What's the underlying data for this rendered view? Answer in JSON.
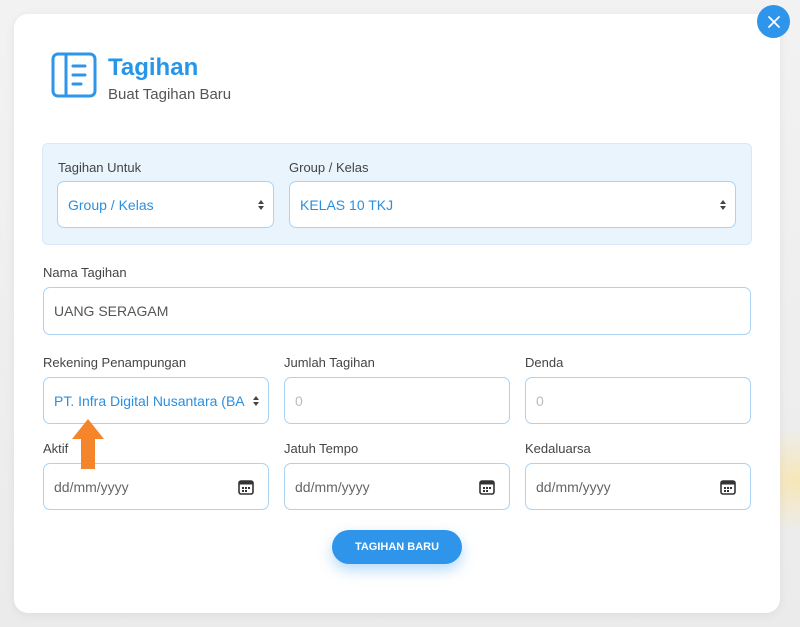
{
  "header": {
    "title": "Tagihan",
    "subtitle": "Buat Tagihan Baru",
    "icon": "book-icon"
  },
  "close_icon": "close-icon",
  "panel": {
    "target_label": "Tagihan Untuk",
    "target_value": "Group / Kelas",
    "group_label": "Group / Kelas",
    "group_value": "KELAS 10 TKJ"
  },
  "form": {
    "name_label": "Nama Tagihan",
    "name_value": "UANG SERAGAM",
    "account_label": "Rekening Penampungan",
    "account_value": "PT. Infra Digital Nusantara (BA",
    "amount_label": "Jumlah Tagihan",
    "amount_placeholder": "0",
    "fine_label": "Denda",
    "fine_placeholder": "0",
    "active_label": "Aktif",
    "active_value": "dd/mm/yyyy",
    "due_label": "Jatuh Tempo",
    "due_value": "dd/mm/yyyy",
    "expiry_label": "Kedaluarsa",
    "expiry_value": "dd/mm/yyyy",
    "submit_label": "TAGIHAN BARU"
  },
  "colors": {
    "accent": "#2e95ea",
    "title": "#2596ea",
    "arrow": "#f5852a",
    "panel_bg": "#eaf4fd"
  }
}
